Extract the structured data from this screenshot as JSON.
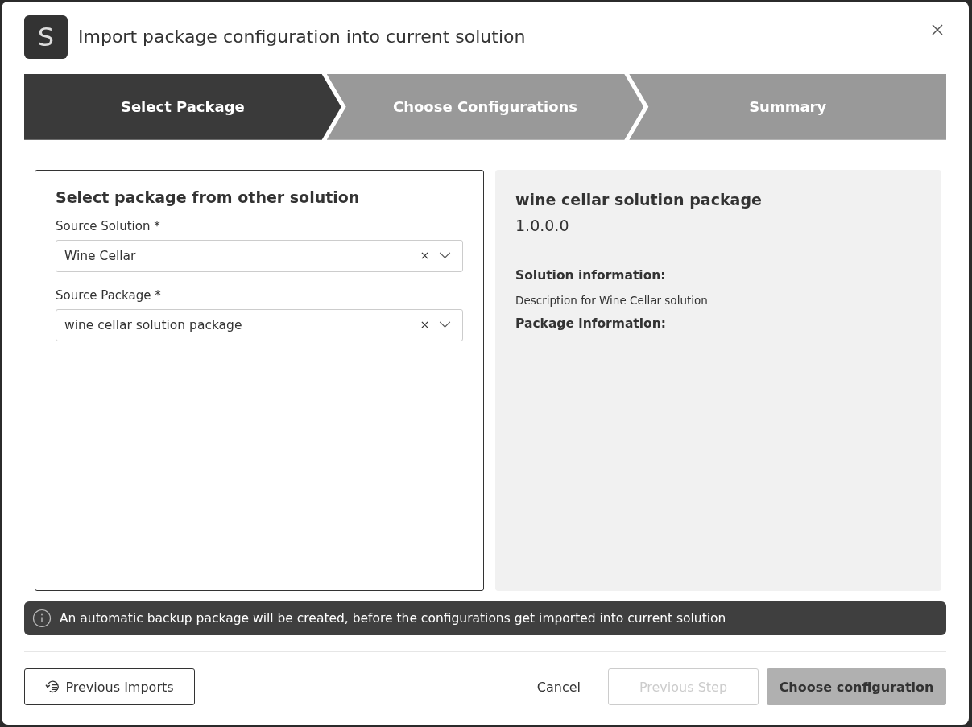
{
  "window": {
    "logo_letter": "S",
    "title": "Import package configuration into current solution"
  },
  "steps": [
    {
      "label": "Select Package",
      "selected": true
    },
    {
      "label": "Choose Configurations",
      "selected": false
    },
    {
      "label": "Summary",
      "selected": false
    }
  ],
  "left_panel": {
    "heading": "Select package from other solution",
    "fields": [
      {
        "label": "Source Solution *",
        "value": "Wine Cellar"
      },
      {
        "label": "Source Package *",
        "value": "wine cellar solution package"
      }
    ]
  },
  "right_panel": {
    "title": "wine cellar solution package",
    "version": "1.0.0.0",
    "sections": [
      {
        "heading": "Solution information:",
        "text": "Description for Wine Cellar solution"
      },
      {
        "heading": "Package information:"
      }
    ]
  },
  "notice": "An automatic backup package will be created, before the configurations get imported into current solution",
  "footer": {
    "history_button": "Previous Imports",
    "cancel": "Cancel",
    "previous": {
      "label": "Previous Step",
      "disabled": true
    },
    "next": {
      "label": "Choose configuration",
      "disabled": true
    }
  }
}
